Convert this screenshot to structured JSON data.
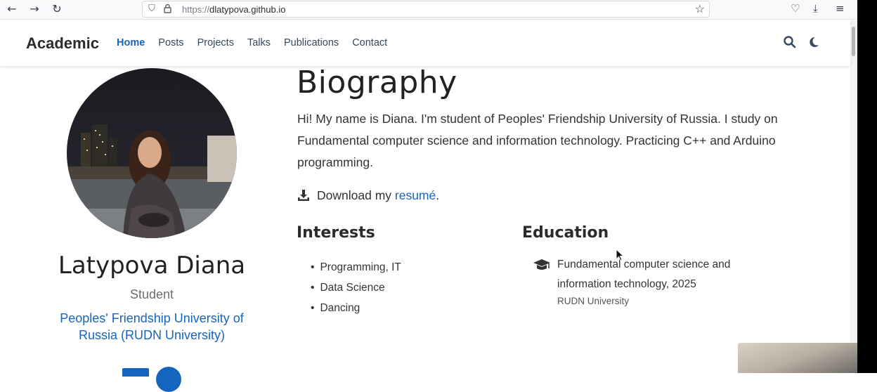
{
  "browser": {
    "url_protocol": "https://",
    "url_domain": "dlatypova.github.io",
    "back_icon": "back-arrow-icon",
    "forward_icon": "forward-arrow-icon",
    "reload_icon": "reload-icon"
  },
  "navbar": {
    "brand": "Academic",
    "links": [
      "Home",
      "Posts",
      "Projects",
      "Talks",
      "Publications",
      "Contact"
    ],
    "active_link": "Home"
  },
  "profile": {
    "name": "Latypova Diana",
    "role": "Student",
    "organization": "Peoples' Friendship University of Russia (RUDN University)"
  },
  "biography": {
    "heading": "Biography",
    "text": "Hi! My name is Diana. I'm student of Peoples' Friendship University of Russia. I study on Fundamental computer science and information technology. Practicing C++ and Arduino programming.",
    "download_prefix": "Download my ",
    "download_link": "resumé",
    "download_suffix": "."
  },
  "interests": {
    "title": "Interests",
    "items": [
      "Programming, IT",
      "Data Science",
      "Dancing"
    ]
  },
  "education": {
    "title": "Education",
    "course": "Fundamental computer science and information technology, 2025",
    "institution": "RUDN University"
  },
  "colors": {
    "accent": "#1565c0",
    "text": "#333333"
  }
}
